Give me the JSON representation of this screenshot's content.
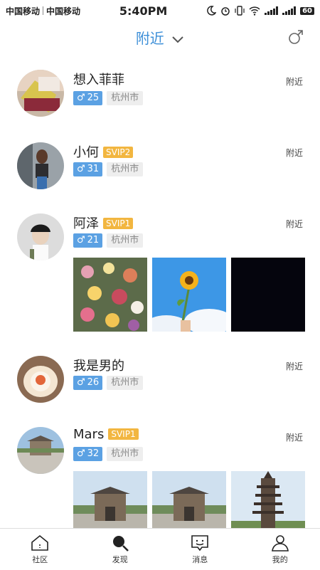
{
  "status_bar": {
    "carrier1": "中国移动",
    "carrier2": "中国移动",
    "time": "5:40PM",
    "battery": "60"
  },
  "header": {
    "title": "附近"
  },
  "users": [
    {
      "name": "想入菲菲",
      "vip": "",
      "age": "25",
      "city": "杭州市",
      "distance": "附近"
    },
    {
      "name": "小何",
      "vip": "SVIP2",
      "age": "31",
      "city": "杭州市",
      "distance": "附近"
    },
    {
      "name": "阿泽",
      "vip": "SVIP1",
      "age": "21",
      "city": "杭州市",
      "distance": "附近"
    },
    {
      "name": "我是男的",
      "vip": "",
      "age": "26",
      "city": "杭州市",
      "distance": "附近"
    },
    {
      "name": "Mars",
      "vip": "SVIP1",
      "age": "32",
      "city": "杭州市",
      "distance": "附近"
    }
  ],
  "tabbar": {
    "tabs": [
      {
        "label": "社区"
      },
      {
        "label": "发现"
      },
      {
        "label": "消息"
      },
      {
        "label": "我的"
      }
    ]
  },
  "colors": {
    "accent": "#3d8fd8",
    "vip": "#f2b640",
    "gender_tag": "#5ba1e3"
  }
}
